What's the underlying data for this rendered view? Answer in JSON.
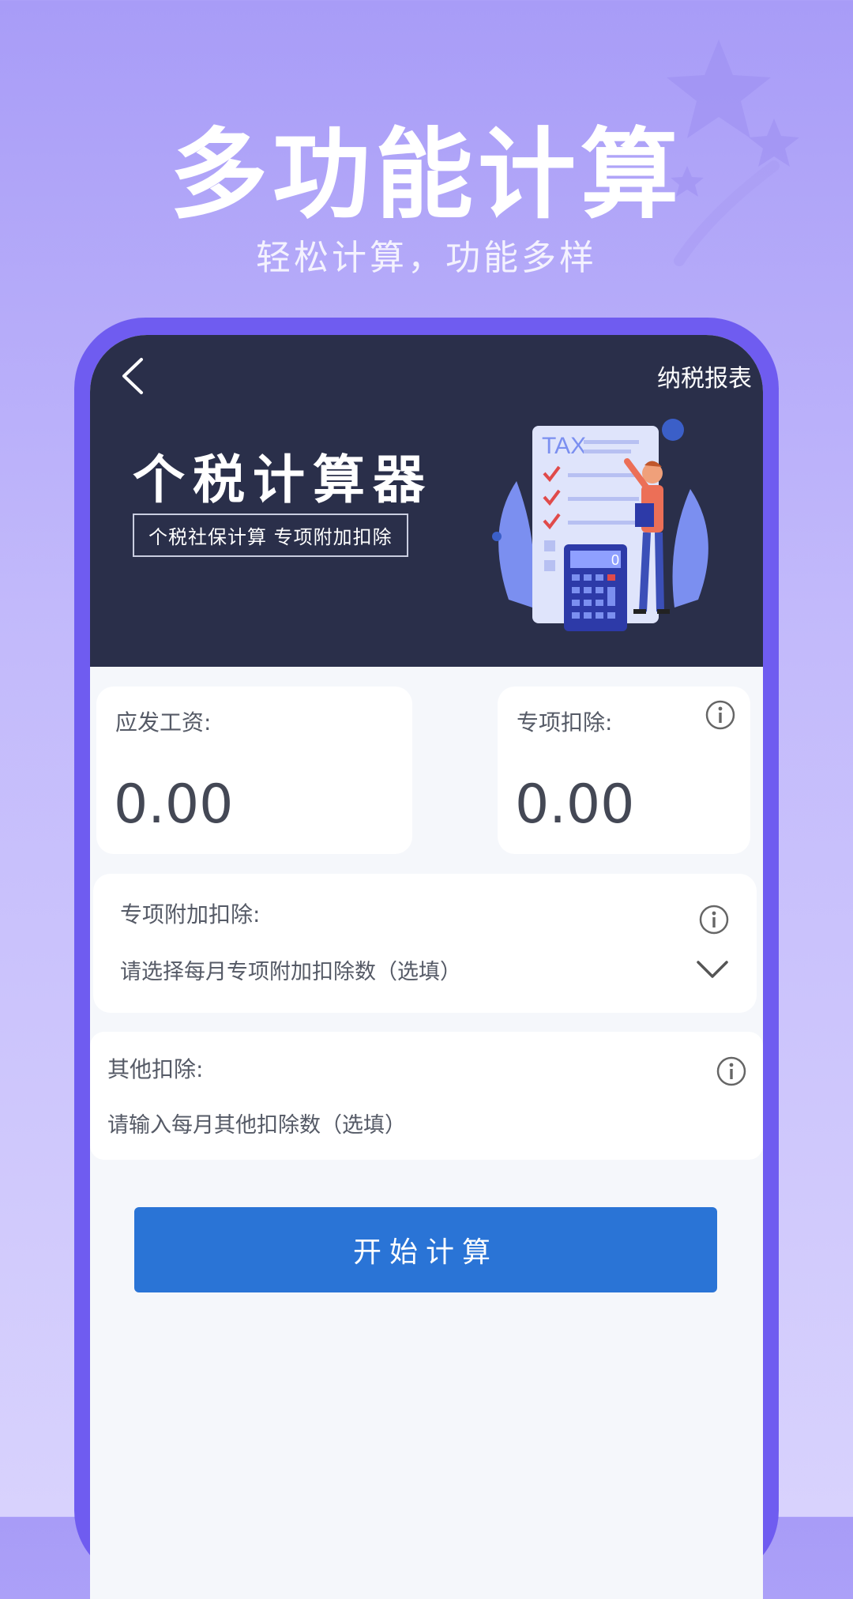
{
  "promo": {
    "title": "多功能计算",
    "subtitle": "轻松计算，功能多样"
  },
  "header": {
    "back_icon": "chevron-left-icon",
    "report_link": "纳税报表"
  },
  "hero": {
    "title": "个税计算器",
    "tagline": "个税社保计算  专项附加扣除",
    "illustration_text": "TAX",
    "calculator_display": "0"
  },
  "salary_card": {
    "label": "应发工资:",
    "value": "0.00"
  },
  "deduction_card": {
    "label": "专项扣除:",
    "value": "0.00",
    "icon": "info-icon"
  },
  "additional_deduction": {
    "label": "专项附加扣除:",
    "placeholder": "请选择每月专项附加扣除数（选填）",
    "icon": "info-icon",
    "dropdown_icon": "chevron-down-icon"
  },
  "other_deduction": {
    "label": "其他扣除:",
    "placeholder": "请输入每月其他扣除数（选填）",
    "icon": "info-icon"
  },
  "actions": {
    "start_label": "开始计算"
  },
  "colors": {
    "background": "#b3a9f9",
    "frame": "#6f5cf0",
    "hero": "#2a2f4a",
    "primary_button": "#2a74d6"
  }
}
